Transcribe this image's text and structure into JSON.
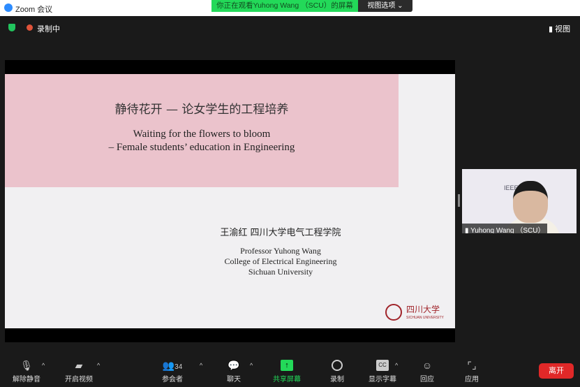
{
  "window": {
    "title": "Zoom 会议"
  },
  "banner": {
    "text": "你正在观看Yuhong Wang （SCU）的屏幕",
    "view_options": "视图选项 ⌄"
  },
  "topbar": {
    "recording": "录制中",
    "view": "视图"
  },
  "slide": {
    "title_zh": "静待花开 — 论女学生的工程培养",
    "title_en_1": "Waiting for the flowers to bloom",
    "title_en_2": "– Female students’ education in Engineering",
    "author_zh": "王渝红  四川大学电气工程学院",
    "author_1": "Professor Yuhong Wang",
    "author_2": "College of Electrical Engineering",
    "author_3": "Sichuan University",
    "logo_zh": "四川大学",
    "logo_en": "SICHUAN UNIVERSITY"
  },
  "thumbnail": {
    "name": "Yuhong Wang （SCU）",
    "bg_text": "IEEE"
  },
  "toolbar": {
    "unmute": "解除静音",
    "video": "开启视频",
    "participants": "参会者",
    "participants_count": "34",
    "chat": "聊天",
    "share": "共享屏幕",
    "record": "录制",
    "captions": "显示字幕",
    "reactions": "回应",
    "apps": "应用",
    "leave": "离开"
  },
  "colors": {
    "share_green": "#23d959",
    "leave_red": "#e02828",
    "slide_pink": "#ebc3cc"
  }
}
